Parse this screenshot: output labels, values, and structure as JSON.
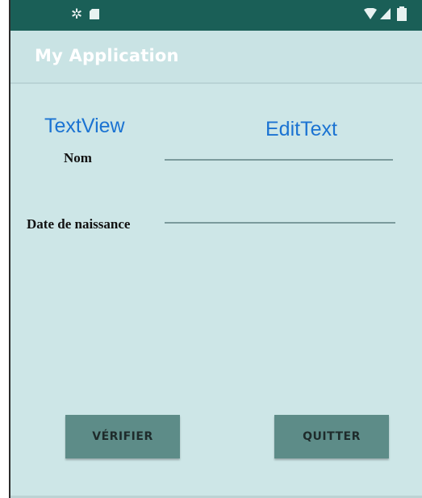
{
  "status_bar": {
    "icons": [
      "gear-icon",
      "sd-card-icon",
      "wifi-icon",
      "signal-icon",
      "battery-icon"
    ]
  },
  "app_bar": {
    "title": "My Application"
  },
  "annotations": {
    "textview": "TextView",
    "edittext": "EditText"
  },
  "form": {
    "name_label": "Nom",
    "birthdate_label": "Date de naissance"
  },
  "buttons": {
    "verify": "VÉRIFIER",
    "quit": "QUITTER"
  },
  "colors": {
    "status_bar": "#1a5f57",
    "background": "#cde6e7",
    "annotation_blue": "#1b73d2",
    "button": "#5d8c88"
  }
}
